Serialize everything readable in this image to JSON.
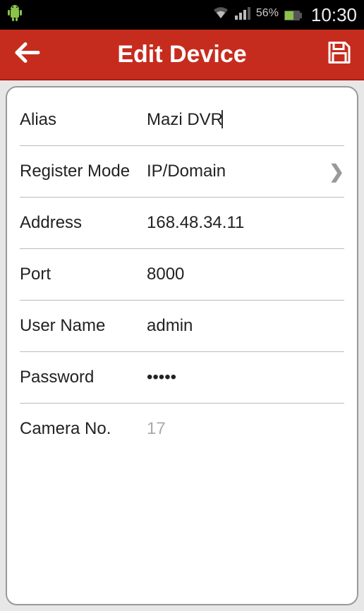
{
  "status": {
    "battery_pct": "56%",
    "time": "10:30"
  },
  "titlebar": {
    "title": "Edit Device"
  },
  "form": {
    "alias": {
      "label": "Alias",
      "value": "Mazi DVR"
    },
    "register_mode": {
      "label": "Register Mode",
      "value": "IP/Domain"
    },
    "address": {
      "label": "Address",
      "value": "168.48.34.11"
    },
    "port": {
      "label": "Port",
      "value": "8000"
    },
    "user_name": {
      "label": "User Name",
      "value": "admin"
    },
    "password": {
      "label": "Password",
      "value": "•••••"
    },
    "camera_no": {
      "label": "Camera No.",
      "value": "17"
    }
  }
}
